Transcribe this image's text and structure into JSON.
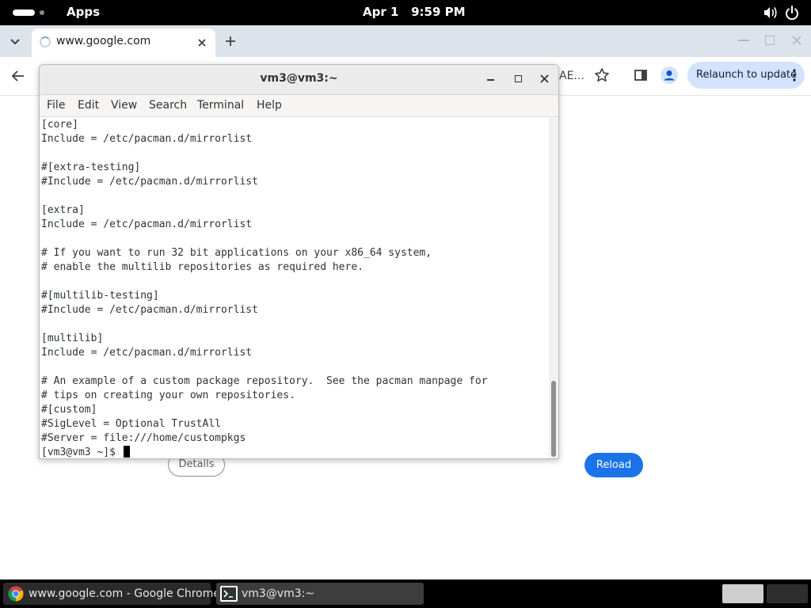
{
  "topbar": {
    "apps_label": "Apps",
    "clock": "Apr 1   9:59 PM",
    "icons": [
      "volume-icon",
      "power-icon"
    ]
  },
  "chrome": {
    "tab_title": "www.google.com",
    "omnibox_tail": "AE...",
    "relaunch_label": "Relaunch to update",
    "details_label": "Details",
    "reload_label": "Reload",
    "accent": "#1a73e8",
    "relaunch_bg": "#d3e3fd"
  },
  "terminal": {
    "title": "vm3@vm3:~",
    "menu": [
      "File",
      "Edit",
      "View",
      "Search",
      "Terminal",
      "Help"
    ],
    "lines": [
      "[core]",
      "Include = /etc/pacman.d/mirrorlist",
      "",
      "#[extra-testing]",
      "#Include = /etc/pacman.d/mirrorlist",
      "",
      "[extra]",
      "Include = /etc/pacman.d/mirrorlist",
      "",
      "# If you want to run 32 bit applications on your x86_64 system,",
      "# enable the multilib repositories as required here.",
      "",
      "#[multilib-testing]",
      "#Include = /etc/pacman.d/mirrorlist",
      "",
      "[multilib]",
      "Include = /etc/pacman.d/mirrorlist",
      "",
      "# An example of a custom package repository.  See the pacman manpage for",
      "# tips on creating your own repositories.",
      "#[custom]",
      "#SigLevel = Optional TrustAll",
      "#Server = file:///home/custompkgs"
    ],
    "prompt": "[vm3@vm3 ~]$ "
  },
  "taskbar": {
    "chrome_task": "www.google.com - Google Chrome",
    "terminal_task": "vm3@vm3:~"
  }
}
